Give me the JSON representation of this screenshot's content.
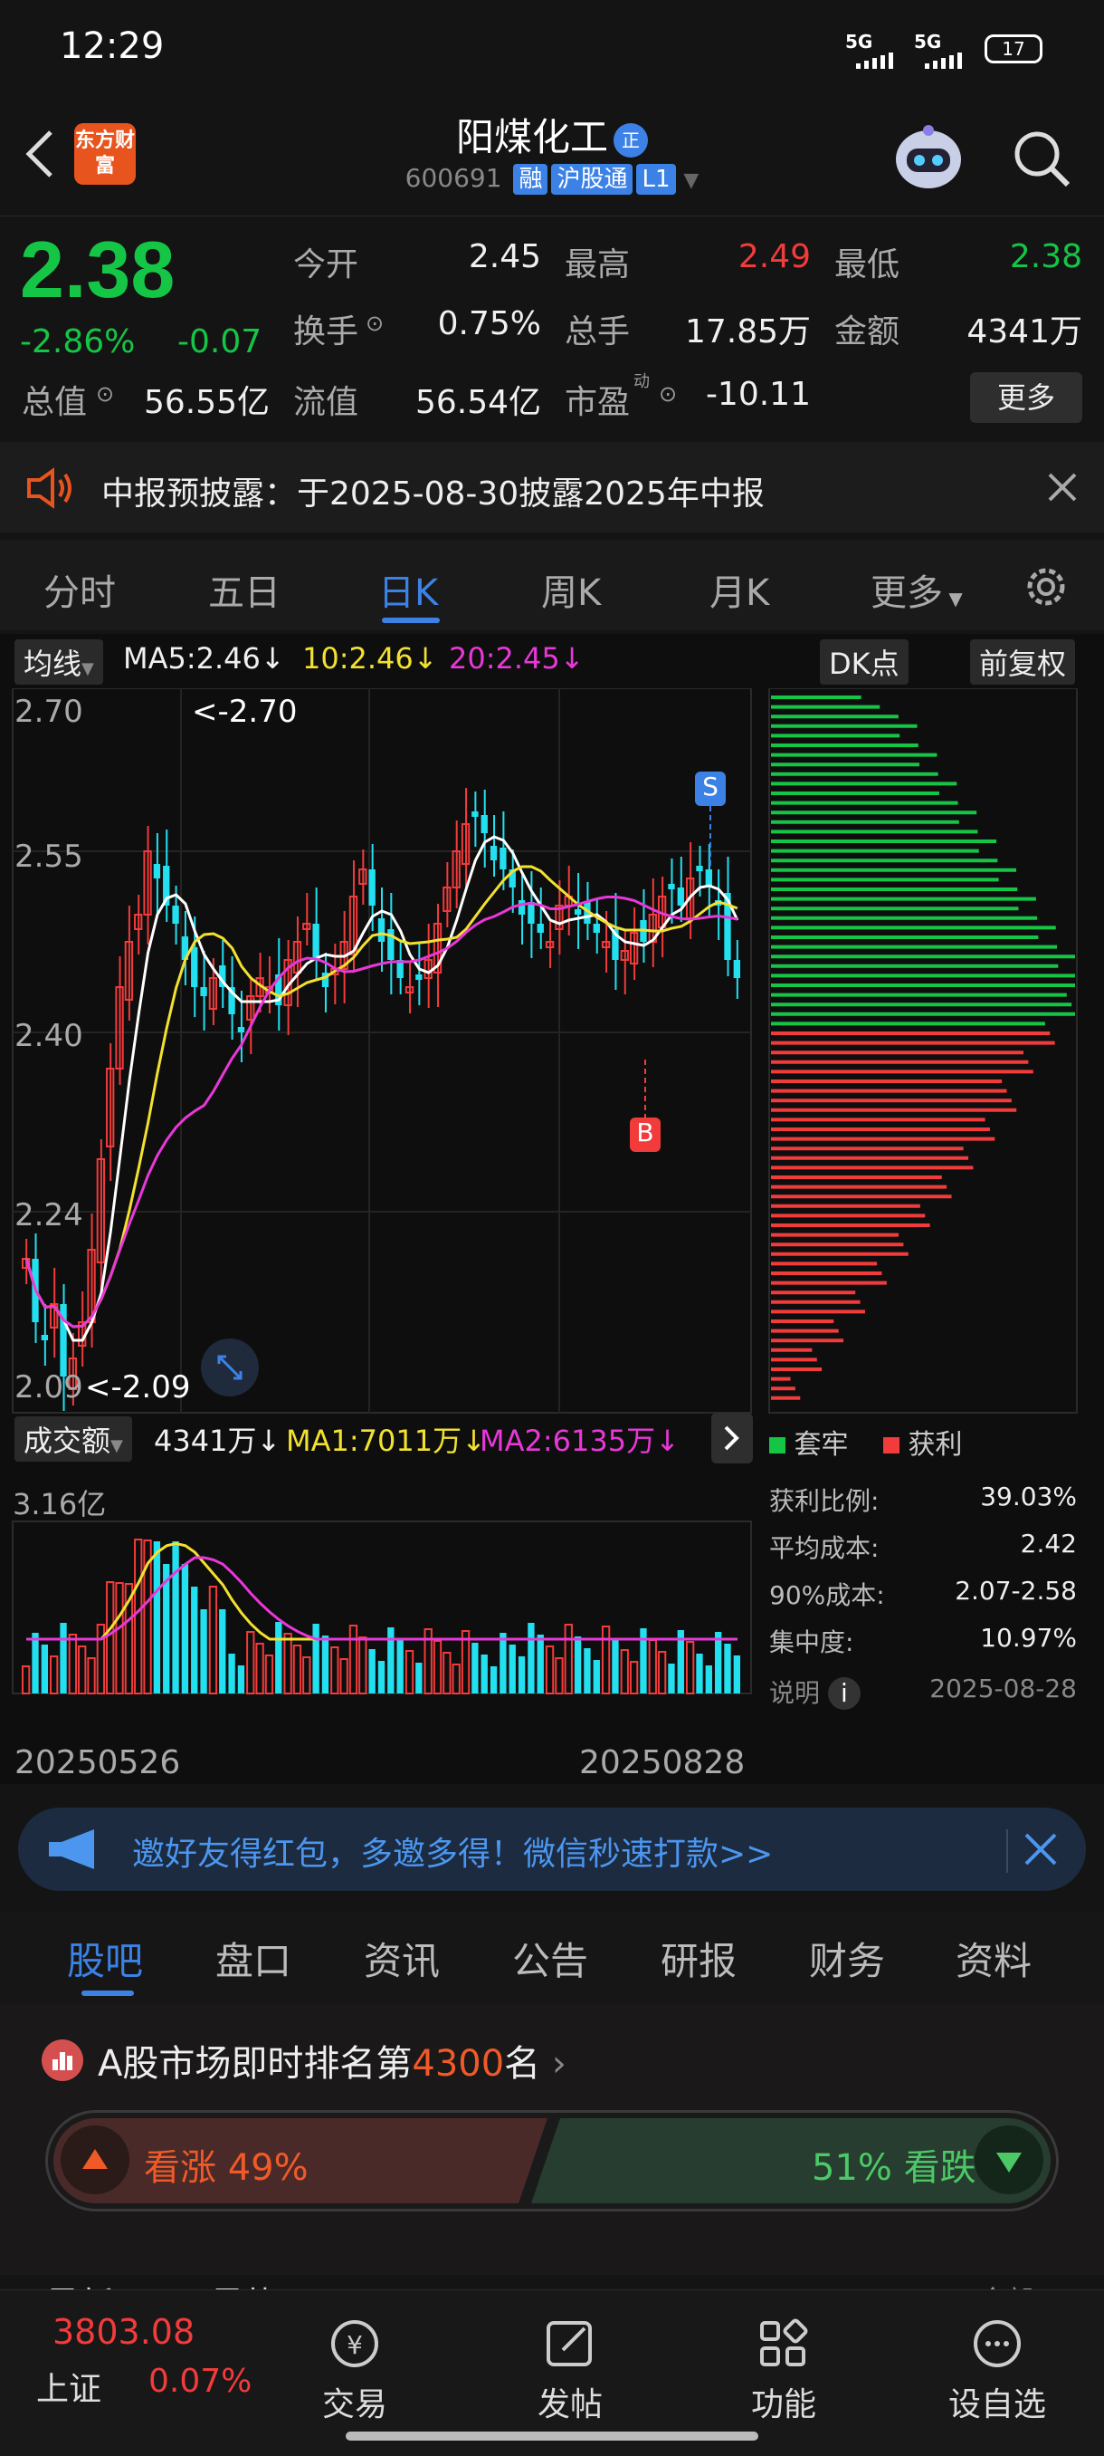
{
  "status": {
    "time": "12:29",
    "signal1": "5G",
    "signal2": "5G",
    "battery": "17"
  },
  "header": {
    "name": "阳煤化工",
    "code": "600691",
    "tags": [
      "融",
      "沪股通",
      "L1"
    ],
    "logo": "东方财富",
    "cert": "正"
  },
  "quote": {
    "price": "2.38",
    "change_pct": "-2.86%",
    "change": "-0.07",
    "open_label": "今开",
    "open": "2.45",
    "high_label": "最高",
    "high": "2.49",
    "low_label": "最低",
    "low": "2.38",
    "turnover_label": "换手",
    "turnover": "0.75%",
    "volume_label": "总手",
    "volume": "17.85万",
    "amount_label": "金额",
    "amount": "4341万",
    "mcap_label": "总值",
    "mcap": "56.55亿",
    "float_label": "流值",
    "float": "56.54亿",
    "pe_label": "市盈",
    "pe_sup": "动",
    "pe": "-10.11",
    "more": "更多"
  },
  "notice": {
    "text": "中报预披露：于2025-08-30披露2025年中报"
  },
  "ktabs": [
    "分时",
    "五日",
    "日K",
    "周K",
    "月K",
    "更多"
  ],
  "ma": {
    "selector": "均线",
    "ma5": "MA5:2.46",
    "ma10": "10:2.46",
    "ma20": "20:2.45",
    "dk": "DK点",
    "adjust": "前复权"
  },
  "price_axis": [
    "2.70",
    "2.55",
    "2.40",
    "2.24",
    "2.09"
  ],
  "annotations": {
    "high": "<-2.70",
    "low": "<-2.09",
    "sell": "S",
    "buy": "B"
  },
  "volume_header": {
    "selector": "成交额",
    "value": "4341万",
    "ma1": "MA1:7011万",
    "ma2": "MA2:6135万",
    "max": "3.16亿"
  },
  "dates": {
    "start": "20250526",
    "end": "20250828"
  },
  "chip": {
    "legend_trapped": "套牢",
    "legend_profit": "获利",
    "rows": [
      {
        "label": "获利比例:",
        "value": "39.03%"
      },
      {
        "label": "平均成本:",
        "value": "2.42"
      },
      {
        "label": "90%成本:",
        "value": "2.07-2.58"
      },
      {
        "label": "集中度:",
        "value": "10.97%"
      }
    ],
    "note": "说明",
    "date": "2025-08-28"
  },
  "banner": {
    "text": "邀好友得红包，多邀多得！微信秒速打款>>"
  },
  "btabs": [
    "股吧",
    "盘口",
    "资讯",
    "公告",
    "研报",
    "财务",
    "资料"
  ],
  "ranking": {
    "prefix": "A股市场即时排名第",
    "rank": "4300",
    "suffix": "名",
    "bull": "看涨 49%",
    "bear": "51% 看跌",
    "latest": "最新",
    "hot": "最热",
    "all": "全部"
  },
  "bottomnav": {
    "index_value": "3803.08",
    "index_name": "上证",
    "index_change": "0.07%",
    "trade": "交易",
    "post": "发帖",
    "func": "功能",
    "watch": "设自选"
  },
  "colors": {
    "up": "#f23b3b",
    "down": "#15c646",
    "accent": "#3c82e6",
    "candle_down": "#23e0f0"
  }
}
